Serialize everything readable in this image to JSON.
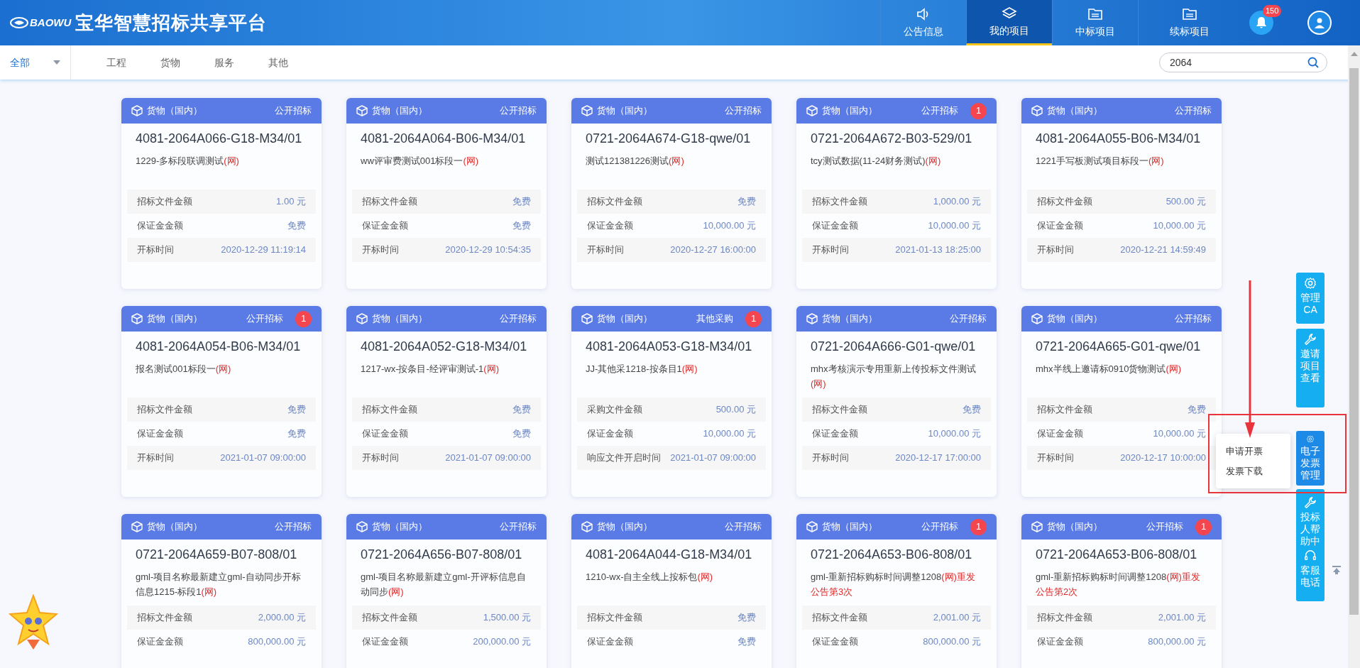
{
  "header": {
    "logo_text": "BAOWU",
    "title": "宝华智慧招标共享平台",
    "nav": [
      {
        "label": "公告信息",
        "selected": false
      },
      {
        "label": "我的项目",
        "selected": true
      },
      {
        "label": "中标项目",
        "selected": false
      },
      {
        "label": "续标项目",
        "selected": false
      }
    ],
    "notifications": "150"
  },
  "filter": {
    "dropdown": "全部",
    "tabs": [
      {
        "label": "工程",
        "selected": false
      },
      {
        "label": "货物",
        "selected": false
      },
      {
        "label": "服务",
        "selected": false
      },
      {
        "label": "其他",
        "selected": false
      }
    ],
    "search": {
      "value": "2064"
    }
  },
  "cards": [
    {
      "category": "货物（国内）",
      "method": "公开招标",
      "code": "4081-2064A066-G18-M34/01",
      "desc": "1229-多标段联调测试",
      "tag": "(网)",
      "rows": [
        {
          "label": "招标文件金额",
          "value": "1.00 元"
        },
        {
          "label": "保证金金额",
          "value": "免费"
        },
        {
          "label": "开标时间",
          "value": "2020-12-29 11:19:14"
        }
      ]
    },
    {
      "category": "货物（国内）",
      "method": "公开招标",
      "code": "4081-2064A064-B06-M34/01",
      "desc": "ww评审费测试001标段一",
      "tag": "(网)",
      "rows": [
        {
          "label": "招标文件金额",
          "value": "免费"
        },
        {
          "label": "保证金金额",
          "value": "免费"
        },
        {
          "label": "开标时间",
          "value": "2020-12-29 10:54:35"
        }
      ]
    },
    {
      "category": "货物（国内）",
      "method": "公开招标",
      "code": "0721-2064A674-G18-qwe/01",
      "desc": "测试121381226测试",
      "tag": "(网)",
      "rows": [
        {
          "label": "招标文件金额",
          "value": "免费"
        },
        {
          "label": "保证金金额",
          "value": "10,000.00 元"
        },
        {
          "label": "开标时间",
          "value": "2020-12-27 16:00:00"
        }
      ]
    },
    {
      "category": "货物（国内）",
      "method": "公开招标",
      "badge": "1",
      "code": "0721-2064A672-B03-529/01",
      "desc": "tcy测试数据(11-24财务测试)",
      "tag": "(网)",
      "rows": [
        {
          "label": "招标文件金额",
          "value": "1,000.00 元"
        },
        {
          "label": "保证金金额",
          "value": "10,000.00 元"
        },
        {
          "label": "开标时间",
          "value": "2021-01-13 18:25:00"
        }
      ]
    },
    {
      "category": "货物（国内）",
      "method": "公开招标",
      "code": "4081-2064A055-B06-M34/01",
      "desc": "1221手写板测试项目标段一",
      "tag": "(网)",
      "rows": [
        {
          "label": "招标文件金额",
          "value": "500.00 元"
        },
        {
          "label": "保证金金额",
          "value": "10,000.00 元"
        },
        {
          "label": "开标时间",
          "value": "2020-12-21 14:59:49"
        }
      ]
    },
    {
      "category": "货物（国内）",
      "method": "公开招标",
      "badge": "1",
      "code": "4081-2064A054-B06-M34/01",
      "desc": "报名测试001标段一",
      "tag": "(网)",
      "rows": [
        {
          "label": "招标文件金额",
          "value": "免费"
        },
        {
          "label": "保证金金额",
          "value": "免费"
        },
        {
          "label": "开标时间",
          "value": "2021-01-07 09:00:00"
        }
      ]
    },
    {
      "category": "货物（国内）",
      "method": "公开招标",
      "code": "4081-2064A052-G18-M34/01",
      "desc": "1217-wx-按条目-经评审测试-1",
      "tag": "(网)",
      "rows": [
        {
          "label": "招标文件金额",
          "value": "免费"
        },
        {
          "label": "保证金金额",
          "value": "免费"
        },
        {
          "label": "开标时间",
          "value": "2021-01-07 09:00:00"
        }
      ]
    },
    {
      "category": "货物（国内）",
      "method": "其他采购",
      "badge": "1",
      "code": "4081-2064A053-G18-M34/01",
      "desc": "JJ-其他采1218-按条目1",
      "tag": "(网)",
      "rows": [
        {
          "label": "采购文件金额",
          "value": "500.00 元"
        },
        {
          "label": "保证金金额",
          "value": "10,000.00 元"
        },
        {
          "label": "响应文件开启时间",
          "value": "2021-01-07 09:00:00"
        }
      ]
    },
    {
      "category": "货物（国内）",
      "method": "公开招标",
      "code": "0721-2064A666-G01-qwe/01",
      "desc": "mhx考核演示专用重新上传投标文件测试",
      "tag": "(网)",
      "rows": [
        {
          "label": "招标文件金额",
          "value": "免费"
        },
        {
          "label": "保证金金额",
          "value": "10,000.00 元"
        },
        {
          "label": "开标时间",
          "value": "2020-12-17 17:00:00"
        }
      ]
    },
    {
      "category": "货物（国内）",
      "method": "公开招标",
      "code": "0721-2064A665-G01-qwe/01",
      "desc": "mhx半线上邀请标0910货物测试",
      "tag": "(网)",
      "rows": [
        {
          "label": "招标文件金额",
          "value": "免费"
        },
        {
          "label": "保证金金额",
          "value": "10,000.00 元"
        },
        {
          "label": "开标时间",
          "value": "2020-12-17 10:00:00"
        }
      ]
    },
    {
      "category": "货物（国内）",
      "method": "公开招标",
      "code": "0721-2064A659-B07-808/01",
      "desc": "gml-项目名称最新建立gml-自动同步开标信息1215-标段1",
      "tag": "(网)",
      "rows": [
        {
          "label": "招标文件金额",
          "value": "2,000.00 元"
        },
        {
          "label": "保证金金额",
          "value": "800,000.00 元"
        }
      ]
    },
    {
      "category": "货物（国内）",
      "method": "公开招标",
      "code": "0721-2064A656-B07-808/01",
      "desc": "gml-项目名称最新建立gml-开评标信息自动同步",
      "tag": "(网)",
      "rows": [
        {
          "label": "招标文件金额",
          "value": "1,500.00 元"
        },
        {
          "label": "保证金金额",
          "value": "200,000.00 元"
        }
      ]
    },
    {
      "category": "货物（国内）",
      "method": "公开招标",
      "code": "4081-2064A044-G18-M34/01",
      "desc": "1210-wx-自主全线上按标包",
      "tag": "(网)",
      "rows": [
        {
          "label": "招标文件金额",
          "value": "免费"
        },
        {
          "label": "保证金金额",
          "value": "免费"
        }
      ]
    },
    {
      "category": "货物（国内）",
      "method": "公开招标",
      "badge": "1",
      "code": "0721-2064A653-B06-808/01",
      "desc": "gml-重新招标购标时间调整1208",
      "tag": "(网)",
      "extra": "重发公告第3次",
      "rows": [
        {
          "label": "招标文件金额",
          "value": "2,001.00 元"
        },
        {
          "label": "保证金金额",
          "value": "800,000.00 元"
        }
      ]
    },
    {
      "category": "货物（国内）",
      "method": "公开招标",
      "badge": "1",
      "code": "0721-2064A653-B06-808/01",
      "desc": "gml-重新招标购标时间调整1208",
      "tag": "(网)",
      "extra": "重发公告第2次",
      "rows": [
        {
          "label": "招标文件金额",
          "value": "2,001.00 元"
        },
        {
          "label": "保证金金额",
          "value": "800,000.00 元"
        }
      ]
    }
  ],
  "side_buttons": [
    {
      "label": "管理CA",
      "selected": false
    },
    {
      "label": "邀请项目查看",
      "selected": false
    },
    {
      "label": "电子发票管理",
      "selected": true
    },
    {
      "label": "投标人帮助中",
      "selected": false,
      "extra_label": "客服电话"
    }
  ],
  "popup_menu": [
    "申请开票",
    "发票下载"
  ]
}
